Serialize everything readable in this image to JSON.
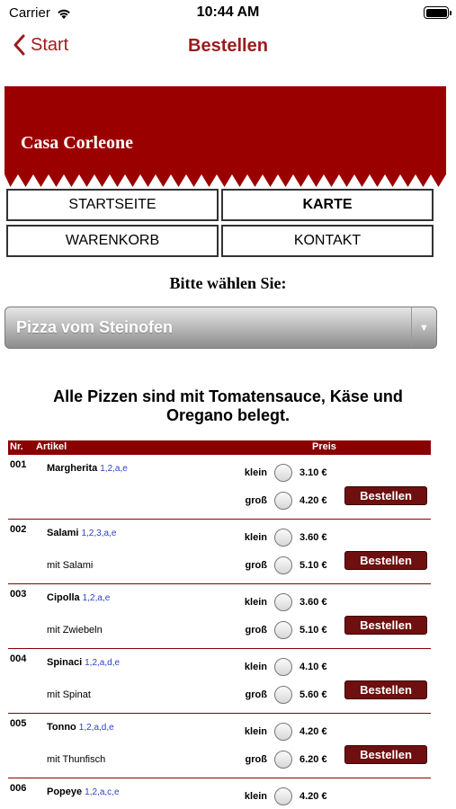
{
  "status": {
    "carrier": "Carrier",
    "time": "10:44 AM"
  },
  "nav": {
    "back_label": "Start",
    "title": "Bestellen"
  },
  "banner": {
    "restaurant_name": "Casa Corleone",
    "color": "#9b0000"
  },
  "menu": {
    "start": "STARTSEITE",
    "karte": "KARTE",
    "warenkorb": "WARENKORB",
    "kontakt": "KONTAKT"
  },
  "choose_label": "Bitte wählen Sie:",
  "category_select": {
    "value": "Pizza vom Steinofen",
    "arrow": "▼"
  },
  "note": "Alle Pizzen sind mit Tomatensauce, Käse und Oregano belegt.",
  "table": {
    "headers": {
      "nr": "Nr.",
      "artikel": "Artikel",
      "preis": "Preis"
    },
    "size_small": "klein",
    "size_large": "groß",
    "order_label": "Bestellen",
    "rows": [
      {
        "nr": "001",
        "name": "Margherita",
        "allergens": "1,2,a,e",
        "desc": "",
        "small": "3.10 €",
        "large": "4.20 €"
      },
      {
        "nr": "002",
        "name": "Salami",
        "allergens": "1,2,3,a,e",
        "desc": "mit Salami",
        "small": "3.60 €",
        "large": "5.10 €"
      },
      {
        "nr": "003",
        "name": "Cipolla",
        "allergens": "1,2,a,e",
        "desc": "mit Zwiebeln",
        "small": "3.60 €",
        "large": "5.10 €"
      },
      {
        "nr": "004",
        "name": "Spinaci",
        "allergens": "1,2,a,d,e",
        "desc": "mit Spinat",
        "small": "4.10 €",
        "large": "5.60 €"
      },
      {
        "nr": "005",
        "name": "Tonno",
        "allergens": "1,2,a,d,e",
        "desc": "mit Thunfisch",
        "small": "4.20 €",
        "large": "6.20 €"
      },
      {
        "nr": "006",
        "name": "Popeye",
        "allergens": "1,2,a,c,e",
        "desc": "",
        "small": "4.20 €",
        "large": ""
      }
    ]
  }
}
